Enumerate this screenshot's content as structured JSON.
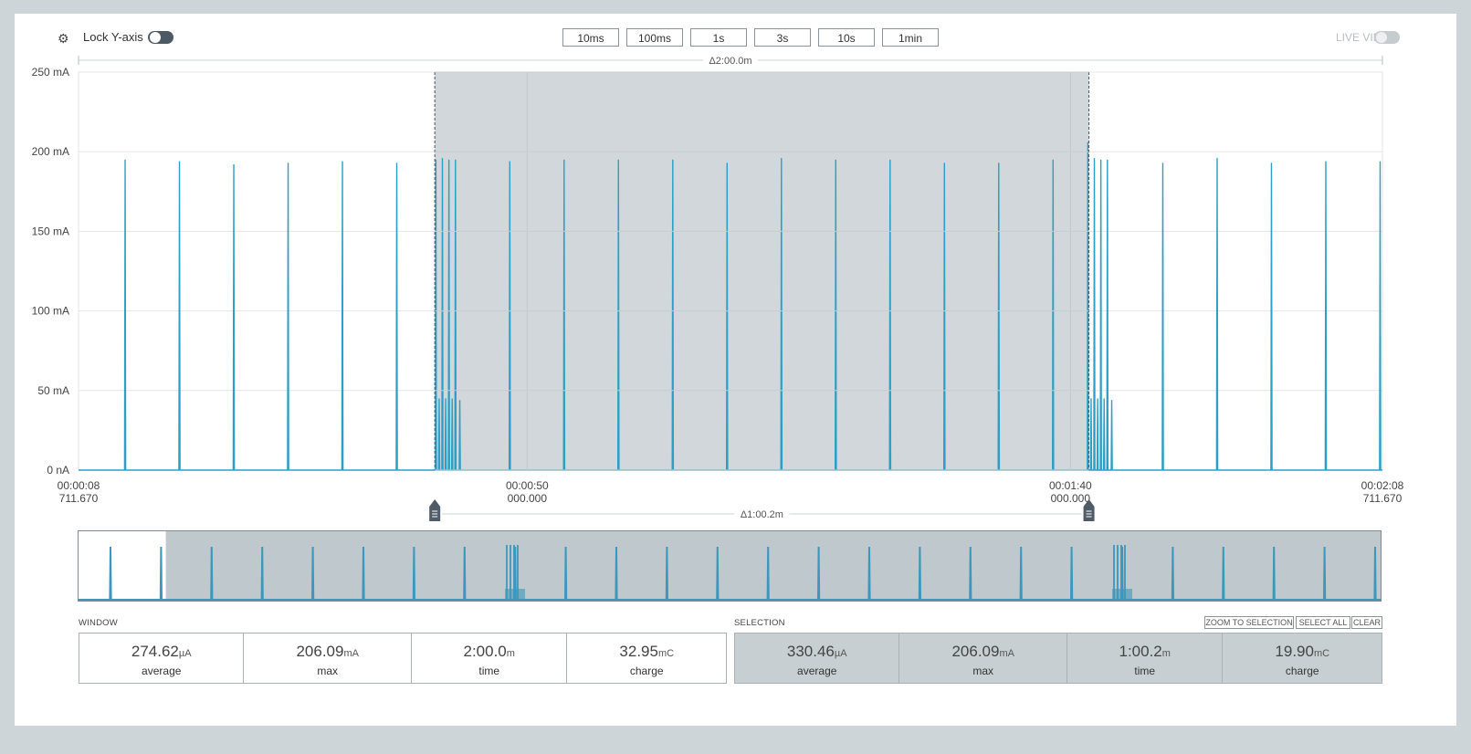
{
  "toolbar": {
    "lock_label": "Lock Y-axis",
    "lock_on": true,
    "zoom_buttons": [
      "10ms",
      "100ms",
      "1s",
      "3s",
      "10s",
      "1min"
    ],
    "live_label": "LIVE VIEW",
    "live_on": false
  },
  "chart": {
    "window_delta": "Δ2:00.0m",
    "selection_delta": "Δ1:00.2m",
    "y_ticks": [
      "250 mA",
      "200 mA",
      "150 mA",
      "100 mA",
      "50 mA",
      "0 nA"
    ],
    "x_ticks": [
      {
        "time": "00:00:08",
        "ms": "711.670"
      },
      {
        "time": "00:00:50",
        "ms": "000.000"
      },
      {
        "time": "00:01:40",
        "ms": "000.000"
      },
      {
        "time": "00:02:08",
        "ms": "711.670"
      }
    ],
    "colors": {
      "line": "#2d9fc6",
      "selection": "#d1d7da",
      "grid": "#e3e6e8"
    }
  },
  "chart_data": {
    "type": "line",
    "title": "",
    "xlabel": "",
    "ylabel": "",
    "ylim": [
      0,
      250
    ],
    "xlim": [
      8.71167,
      128.71167
    ],
    "x_unit": "s",
    "y_unit": "mA",
    "selection": [
      41.5,
      101.7
    ],
    "series": [
      {
        "name": "",
        "spikes": [
          {
            "x": 13.0,
            "y": 195
          },
          {
            "x": 18.0,
            "y": 194
          },
          {
            "x": 23.0,
            "y": 192
          },
          {
            "x": 28.0,
            "y": 193
          },
          {
            "x": 33.0,
            "y": 194
          },
          {
            "x": 38.0,
            "y": 193
          },
          {
            "x": 41.6,
            "y": 195
          },
          {
            "x": 41.9,
            "y": 45
          },
          {
            "x": 42.2,
            "y": 196
          },
          {
            "x": 42.5,
            "y": 45
          },
          {
            "x": 42.8,
            "y": 195
          },
          {
            "x": 43.1,
            "y": 45
          },
          {
            "x": 43.4,
            "y": 195
          },
          {
            "x": 43.8,
            "y": 44
          },
          {
            "x": 48.4,
            "y": 194
          },
          {
            "x": 53.4,
            "y": 195
          },
          {
            "x": 58.4,
            "y": 195
          },
          {
            "x": 63.4,
            "y": 195
          },
          {
            "x": 68.4,
            "y": 193
          },
          {
            "x": 73.4,
            "y": 196
          },
          {
            "x": 78.4,
            "y": 195
          },
          {
            "x": 83.4,
            "y": 195
          },
          {
            "x": 88.4,
            "y": 193
          },
          {
            "x": 93.4,
            "y": 193
          },
          {
            "x": 98.4,
            "y": 195
          },
          {
            "x": 101.6,
            "y": 206
          },
          {
            "x": 101.9,
            "y": 45
          },
          {
            "x": 102.2,
            "y": 196
          },
          {
            "x": 102.5,
            "y": 45
          },
          {
            "x": 102.8,
            "y": 195
          },
          {
            "x": 103.1,
            "y": 45
          },
          {
            "x": 103.4,
            "y": 195
          },
          {
            "x": 103.8,
            "y": 44
          },
          {
            "x": 108.5,
            "y": 193
          },
          {
            "x": 113.5,
            "y": 196
          },
          {
            "x": 118.5,
            "y": 193
          },
          {
            "x": 123.5,
            "y": 194
          },
          {
            "x": 128.5,
            "y": 194
          }
        ]
      }
    ],
    "overview": {
      "window_start_fraction": 0.067
    }
  },
  "window_stats": {
    "title": "WINDOW",
    "items": [
      {
        "value": "274.62",
        "unit": "µA",
        "label": "average"
      },
      {
        "value": "206.09",
        "unit": "mA",
        "label": "max"
      },
      {
        "value": "2:00.0",
        "unit": "m",
        "label": "time"
      },
      {
        "value": "32.95",
        "unit": "mC",
        "label": "charge"
      }
    ]
  },
  "selection_stats": {
    "title": "SELECTION",
    "buttons": [
      "ZOOM TO SELECTION",
      "SELECT ALL",
      "CLEAR"
    ],
    "items": [
      {
        "value": "330.46",
        "unit": "µA",
        "label": "average"
      },
      {
        "value": "206.09",
        "unit": "mA",
        "label": "max"
      },
      {
        "value": "1:00.2",
        "unit": "m",
        "label": "time"
      },
      {
        "value": "19.90",
        "unit": "mC",
        "label": "charge"
      }
    ]
  }
}
